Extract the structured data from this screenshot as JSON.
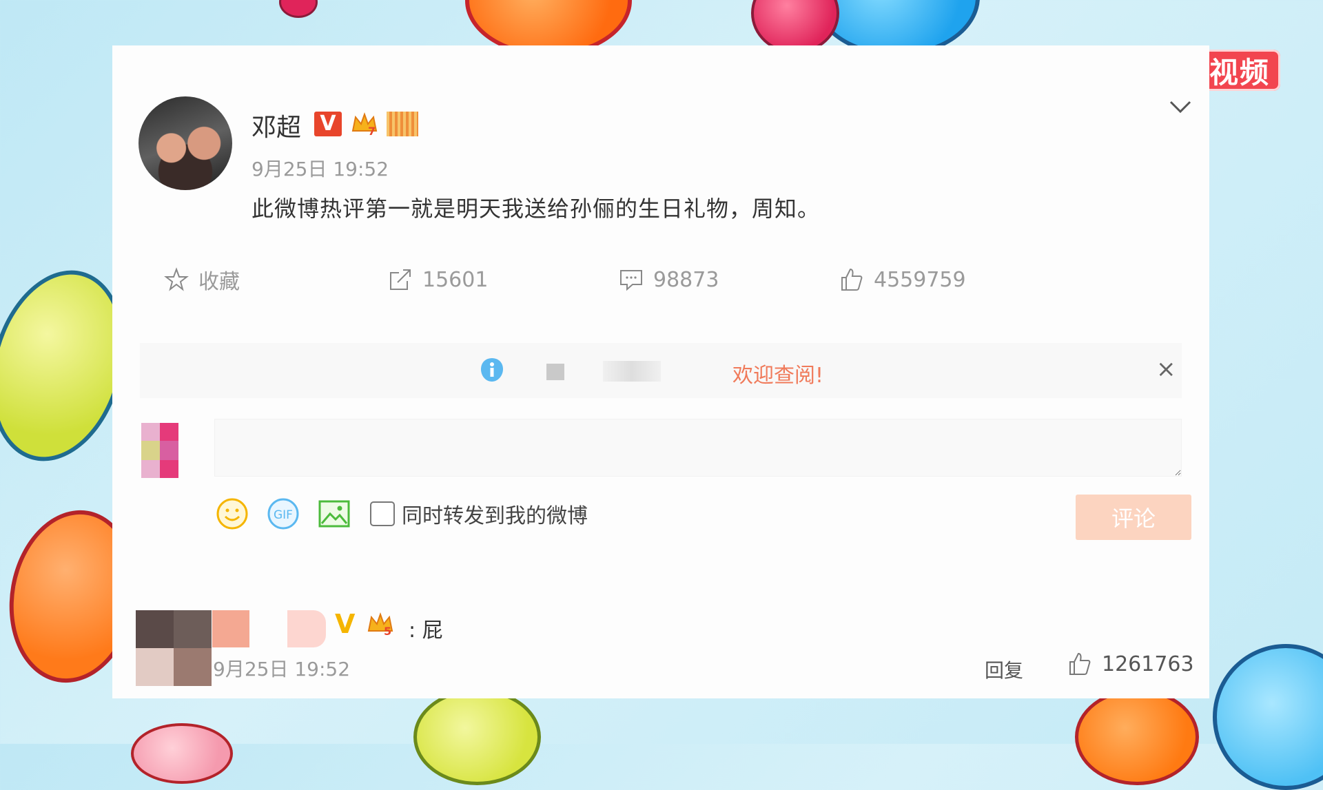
{
  "badge": {
    "label": "视频"
  },
  "post": {
    "username": "邓超",
    "v_badge": "V",
    "timestamp": "9月25日 19:52",
    "text": "此微博热评第一就是明天我送给孙俪的生日礼物，周知。"
  },
  "actions": {
    "favorite_label": "收藏",
    "repost_count": "15601",
    "comment_count": "98873",
    "like_count": "4559759"
  },
  "notice": {
    "text": "欢迎查阅!",
    "close": "×"
  },
  "composer": {
    "input_value": "",
    "repost_checkbox_label": "同时转发到我的微博",
    "submit_label": "评论"
  },
  "reply": {
    "v_badge": "V",
    "text": ": 屁",
    "timestamp": "9月25日 19:52",
    "reply_label": "回复",
    "like_count": "1261763"
  },
  "colors": {
    "accent_orange": "#ff8200",
    "badge_red": "#f2454f",
    "notice_text": "#f07a5a",
    "submit_disabled": "#fcd4c0"
  }
}
